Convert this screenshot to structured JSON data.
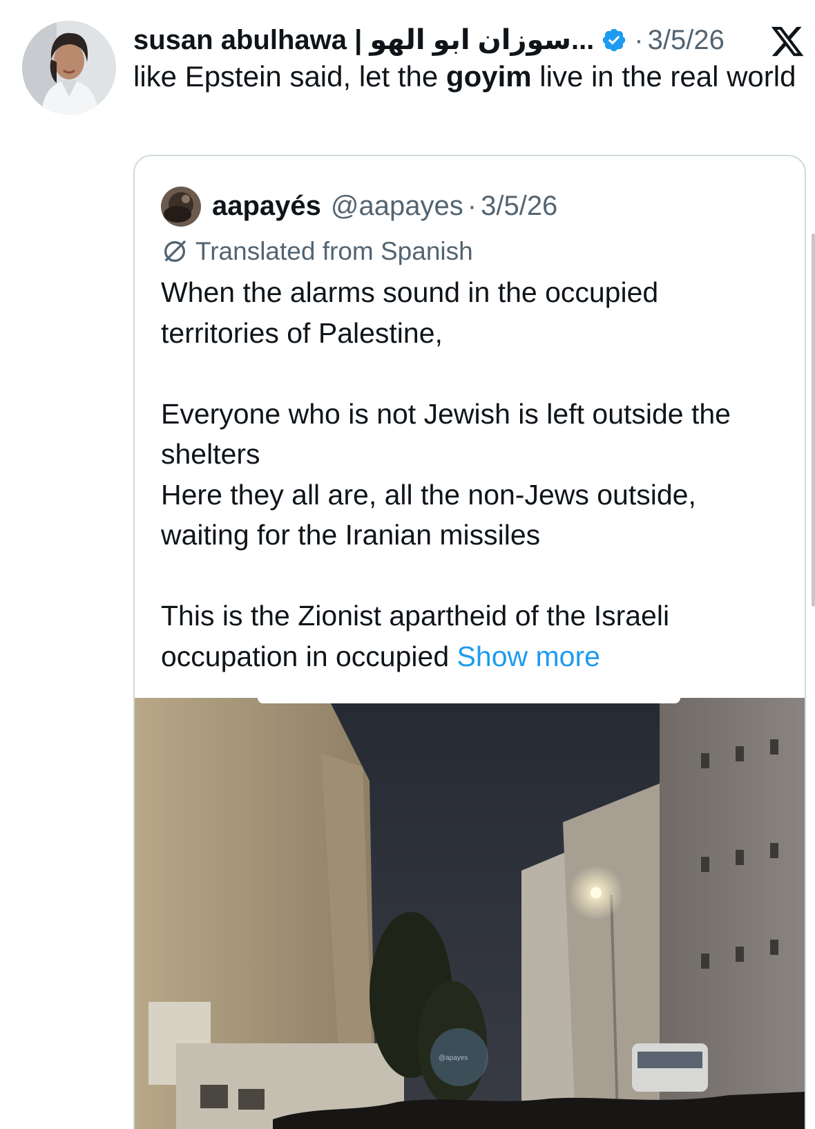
{
  "tweet": {
    "author": {
      "display_name": "susan abulhawa | سوزان ابو الهو...",
      "verified": true
    },
    "separator": "·",
    "date": "3/5/26",
    "text_before": "like Epstein said, let the ",
    "text_bold": "goyim",
    "text_after": " live in the real world",
    "platform_icon": "x-logo-icon"
  },
  "quote": {
    "author": {
      "display_name": "aapayés",
      "handle": "@aapayes"
    },
    "separator": "·",
    "date": "3/5/26",
    "translated_label": "Translated from Spanish",
    "paragraphs": [
      "When the alarms sound in the occupied territories of Palestine,",
      "Everyone who is not Jewish is left outside the shelters",
      "Here they all are, all the non-Jews outside, waiting for the Iranian missiles",
      "This is the Zionist apartheid of the Israeli occupation in occupied"
    ],
    "show_more": "Show more",
    "media": {
      "kind": "video-thumbnail",
      "description_icon": "night-street-photo",
      "watermark": "@apayes"
    }
  },
  "colors": {
    "text": "#0f1419",
    "secondary": "#536471",
    "link": "#1d9bf0",
    "verified": "#1d9bf0",
    "border": "#cfd9de"
  }
}
